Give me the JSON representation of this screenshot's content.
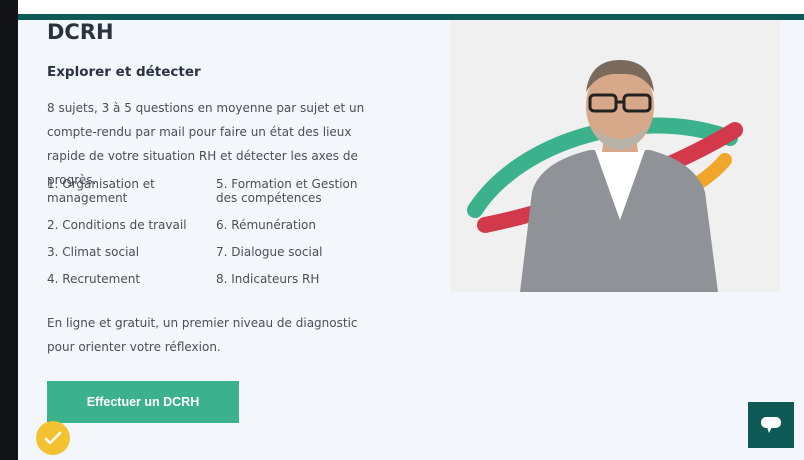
{
  "section": {
    "title": "DCRH",
    "subtitle": "Explorer et détecter",
    "description": "8 sujets, 3 à 5 questions en moyenne par sujet et un compte-rendu par mail pour faire un état des lieux rapide de votre situation RH et détecter les axes de progrès.",
    "topics": [
      "1. Organisation et management",
      "2. Conditions de travail",
      "3. Climat social",
      "4. Recrutement",
      "5. Formation et Gestion des compétences",
      "6. Rémunération",
      "7. Dialogue social",
      "8. Indicateurs RH"
    ],
    "footer_text": "En ligne et gratuit, un premier niveau de diagnostic pour orienter votre réflexion.",
    "cta_label": "Effectuer un DCRH"
  },
  "icons": {
    "chat": "chat-bubble-icon",
    "badge": "checkmark-badge-icon"
  },
  "colors": {
    "accent_green": "#3bb18c",
    "dark_teal": "#0f5a57",
    "badge_yellow": "#f2c230",
    "panel_bg": "#f3f7fb"
  }
}
